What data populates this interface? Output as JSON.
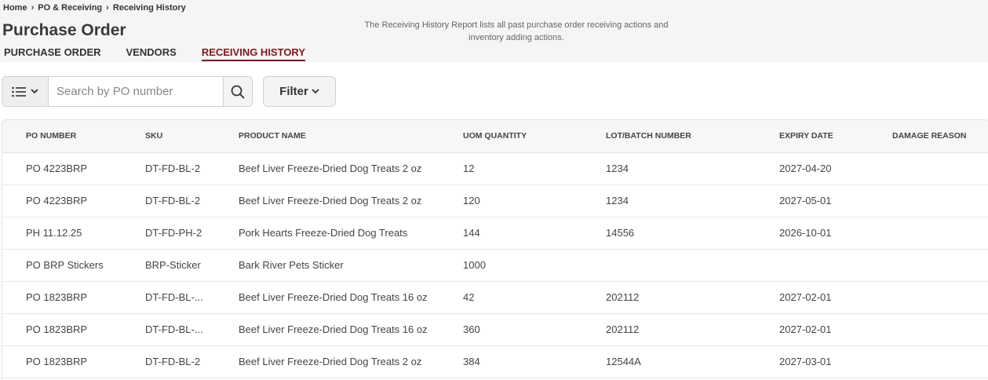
{
  "breadcrumb": [
    "Home",
    "PO & Receiving",
    "Receiving History"
  ],
  "page_title": "Purchase Order",
  "description": "The Receiving History Report lists all past purchase order receiving actions and inventory adding actions.",
  "tabs": [
    {
      "label": "PURCHASE ORDER",
      "active": false
    },
    {
      "label": "VENDORS",
      "active": false
    },
    {
      "label": "RECEIVING HISTORY",
      "active": true
    }
  ],
  "search": {
    "placeholder": "Search by PO number",
    "value": ""
  },
  "filter_label": "Filter",
  "colors": {
    "accent": "#7a1a1f",
    "header_bg": "#f5f5f5"
  },
  "table": {
    "columns": [
      "PO NUMBER",
      "SKU",
      "PRODUCT NAME",
      "UOM QUANTITY",
      "LOT/BATCH NUMBER",
      "EXPIRY DATE",
      "DAMAGE REASON"
    ],
    "rows": [
      [
        "PO 4223BRP",
        "DT-FD-BL-2",
        "Beef Liver Freeze-Dried Dog Treats 2 oz",
        "12",
        "1234",
        "2027-04-20",
        ""
      ],
      [
        "PO 4223BRP",
        "DT-FD-BL-2",
        "Beef Liver Freeze-Dried Dog Treats 2 oz",
        "120",
        "1234",
        "2027-05-01",
        ""
      ],
      [
        "PH 11.12.25",
        "DT-FD-PH-2",
        "Pork Hearts Freeze-Dried Dog Treats",
        "144",
        "14556",
        "2026-10-01",
        ""
      ],
      [
        "PO BRP Stickers",
        "BRP-Sticker",
        "Bark River Pets Sticker",
        "1000",
        "",
        "",
        ""
      ],
      [
        "PO 1823BRP",
        "DT-FD-BL-...",
        "Beef Liver Freeze-Dried Dog Treats 16 oz",
        "42",
        "202112",
        "2027-02-01",
        ""
      ],
      [
        "PO 1823BRP",
        "DT-FD-BL-...",
        "Beef Liver Freeze-Dried Dog Treats 16 oz",
        "360",
        "202112",
        "2027-02-01",
        ""
      ],
      [
        "PO 1823BRP",
        "DT-FD-BL-2",
        "Beef Liver Freeze-Dried Dog Treats 2 oz",
        "384",
        "12544A",
        "2027-03-01",
        ""
      ]
    ]
  }
}
